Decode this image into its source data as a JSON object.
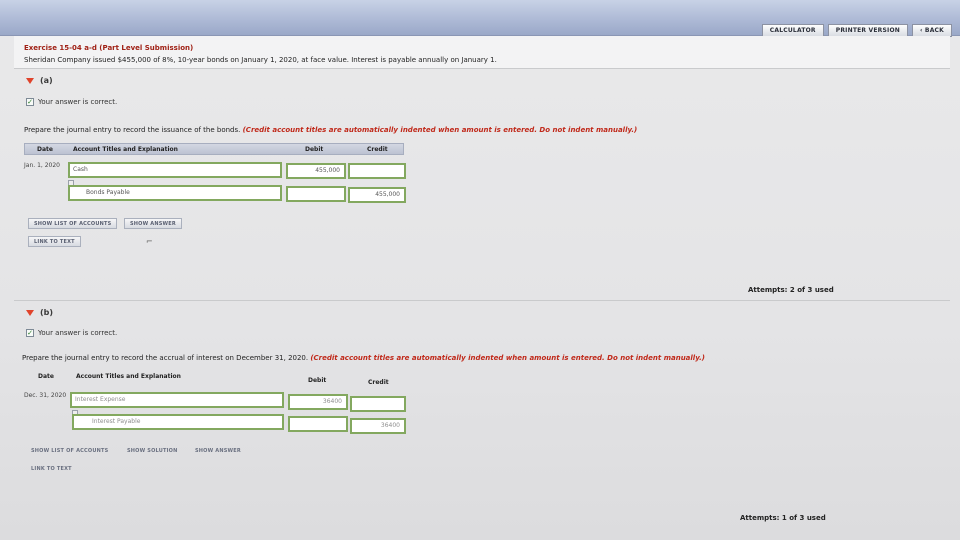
{
  "toolbar": {
    "calculator": "CALCULATOR",
    "printer_version": "PRINTER VERSION",
    "back": "‹ BACK"
  },
  "exercise": {
    "title": "Exercise 15-04 a-d (Part Level Submission)",
    "description": "Sheridan Company issued $455,000 of 8%, 10-year bonds on January 1, 2020, at face value. Interest is payable annually on January 1."
  },
  "part_a": {
    "label": "(a)",
    "status": "Your answer is correct.",
    "prompt": "Prepare the journal entry to record the issuance of the bonds.",
    "note": "(Credit account titles are automatically indented when amount is entered. Do not indent manually.)",
    "headers": {
      "date": "Date",
      "account": "Account Titles and Explanation",
      "debit": "Debit",
      "credit": "Credit"
    },
    "rows": [
      {
        "date": "Jan. 1, 2020",
        "account": "Cash",
        "debit": "455,000",
        "credit": ""
      },
      {
        "date": "",
        "account": "Bonds Payable",
        "debit": "",
        "credit": "455,000"
      }
    ],
    "buttons": {
      "show_list": "SHOW LIST OF ACCOUNTS",
      "show_answer": "SHOW ANSWER",
      "link_to_text": "LINK TO TEXT"
    },
    "attempts": "Attempts: 2 of 3 used"
  },
  "part_b": {
    "label": "(b)",
    "status": "Your answer is correct.",
    "prompt": "Prepare the journal entry to record the accrual of interest on December 31, 2020.",
    "note": "(Credit account titles are automatically indented when amount is entered. Do not indent manually.)",
    "headers": {
      "date": "Date",
      "account": "Account Titles and Explanation",
      "debit": "Debit",
      "credit": "Credit"
    },
    "rows": [
      {
        "date": "Dec. 31, 2020",
        "account": "Interest Expense",
        "debit": "36400",
        "credit": ""
      },
      {
        "date": "",
        "account": "Interest Payable",
        "debit": "",
        "credit": "36400"
      }
    ],
    "buttons": {
      "show_list": "SHOW LIST OF ACCOUNTS",
      "show_solution": "SHOW SOLUTION",
      "show_answer": "SHOW ANSWER",
      "link_to_text": "LINK TO TEXT"
    },
    "attempts": "Attempts: 1 of 3 used"
  }
}
